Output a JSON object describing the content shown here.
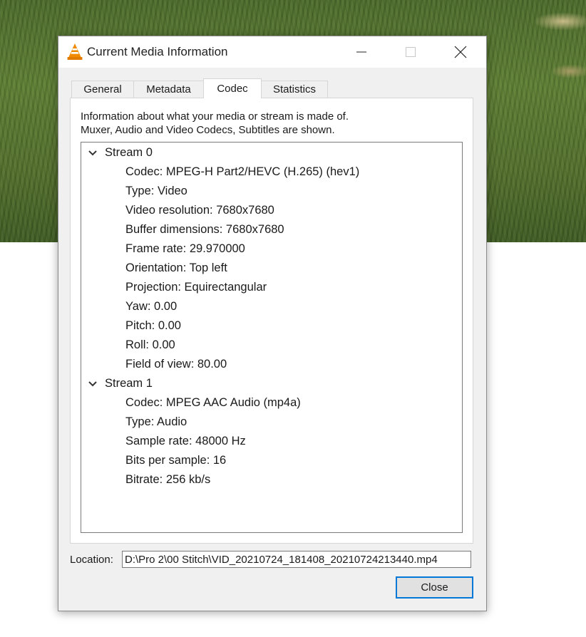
{
  "window": {
    "title": "Current Media Information"
  },
  "tabs": [
    {
      "label": "General",
      "active": false
    },
    {
      "label": "Metadata",
      "active": false
    },
    {
      "label": "Codec",
      "active": true
    },
    {
      "label": "Statistics",
      "active": false
    }
  ],
  "codec": {
    "description_line1": "Information about what your media or stream is made of.",
    "description_line2": "Muxer, Audio and Video Codecs, Subtitles are shown.",
    "streams": [
      {
        "label": "Stream 0",
        "expanded": true,
        "properties": [
          "Codec: MPEG-H Part2/HEVC (H.265) (hev1)",
          "Type: Video",
          "Video resolution: 7680x7680",
          "Buffer dimensions: 7680x7680",
          "Frame rate: 29.970000",
          "Orientation: Top left",
          "Projection: Equirectangular",
          "Yaw: 0.00",
          "Pitch: 0.00",
          "Roll: 0.00",
          "Field of view: 80.00"
        ]
      },
      {
        "label": "Stream 1",
        "expanded": true,
        "properties": [
          "Codec: MPEG AAC Audio (mp4a)",
          "Type: Audio",
          "Sample rate: 48000 Hz",
          "Bits per sample: 16",
          "Bitrate: 256 kb/s"
        ]
      }
    ]
  },
  "location": {
    "label": "Location:",
    "value": "D:\\Pro 2\\00 Stitch\\VID_20210724_181408_20210724213440.mp4"
  },
  "buttons": {
    "close_label": "Close"
  },
  "colors": {
    "accent": "#0078d7",
    "vlc_orange": "#f28a00"
  },
  "icons": {
    "app": "vlc-cone-icon",
    "minimize": "minimize-icon",
    "maximize": "maximize-icon",
    "close": "close-icon",
    "expand": "chevron-down-icon"
  }
}
